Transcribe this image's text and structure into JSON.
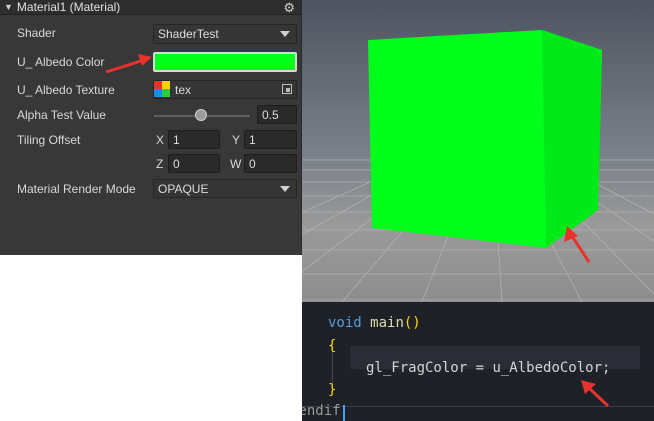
{
  "inspector": {
    "title": "Material1 (Material)",
    "fields": {
      "shader_label": "Shader",
      "shader_value": "ShaderTest",
      "albedo_color_label": "U_ Albedo Color",
      "albedo_color_value": "#00ff1b",
      "albedo_texture_label": "U_ Albedo Texture",
      "albedo_texture_value": "tex",
      "alpha_test_label": "Alpha Test Value",
      "alpha_test_value": "0.5",
      "tiling_label": "Tiling Offset",
      "x_label": "X",
      "x_value": "1",
      "y_label": "Y",
      "y_value": "1",
      "z_label": "Z",
      "z_value": "0",
      "w_label": "W",
      "w_value": "0",
      "render_mode_label": "Material Render Mode",
      "render_mode_value": "OPAQUE"
    }
  },
  "code": {
    "line1_kw": "void",
    "line1_fn": "main",
    "line1_rest": "()",
    "line2": "{",
    "line3_a": "gl_FragColor = ",
    "line3_b": "u_AlbedoColor;",
    "line4": "}",
    "line5": "#endif"
  },
  "colors": {
    "albedo": "#00ff1b",
    "annotation_arrow": "#e8322e"
  },
  "icons": [
    "collapse-triangle-icon",
    "gear-icon",
    "texture-thumbnail-icon",
    "object-picker-icon",
    "dropdown-caret-icon",
    "annotation-arrow-icon"
  ]
}
